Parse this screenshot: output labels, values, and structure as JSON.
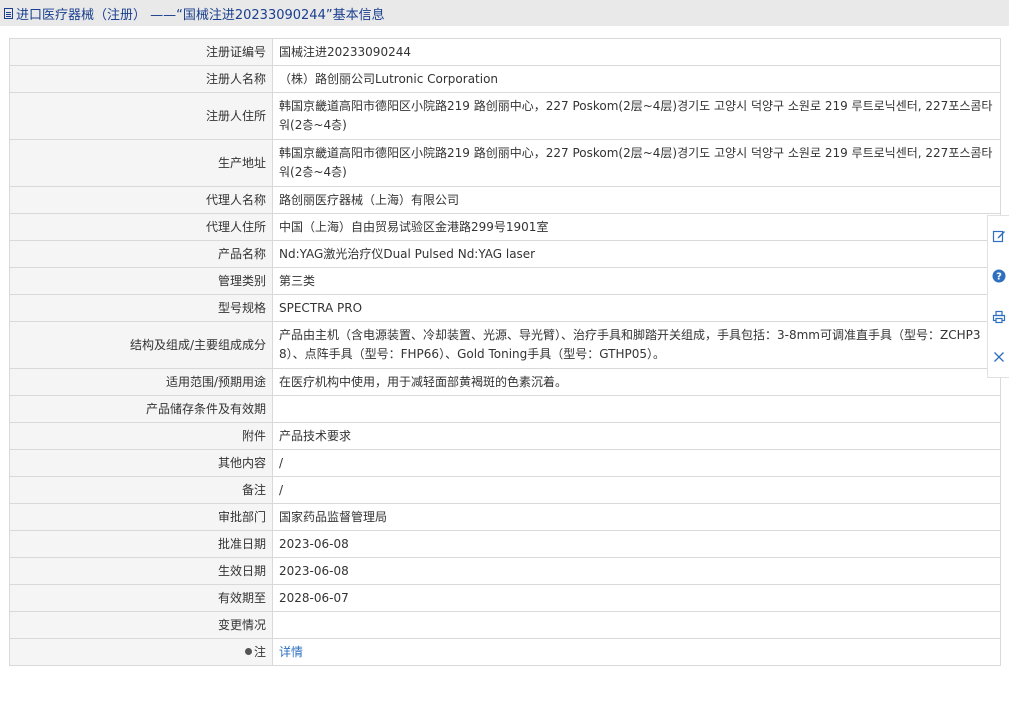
{
  "header": {
    "title": "进口医疗器械（注册） ——“国械注进20233090244”基本信息",
    "icon": "document-icon"
  },
  "rows": [
    {
      "label": "注册证编号",
      "value": "国械注进20233090244"
    },
    {
      "label": "注册人名称",
      "value": "（株）路创丽公司Lutronic Corporation"
    },
    {
      "label": "注册人住所",
      "value": "韩国京畿道高阳市德阳区小院路219 路创丽中心，227 Poskom(2层~4层)경기도 고양시 덕양구 소원로 219 루트로닉센터, 227포스콤타워(2층~4층)"
    },
    {
      "label": "生产地址",
      "value": "韩国京畿道高阳市德阳区小院路219 路创丽中心，227 Poskom(2层~4层)경기도 고양시 덕양구 소원로 219 루트로닉센터, 227포스콤타워(2층~4층)"
    },
    {
      "label": "代理人名称",
      "value": "路创丽医疗器械（上海）有限公司"
    },
    {
      "label": "代理人住所",
      "value": "中国（上海）自由贸易试验区金港路299号1901室"
    },
    {
      "label": "产品名称",
      "value": "Nd:YAG激光治疗仪Dual Pulsed Nd:YAG laser"
    },
    {
      "label": "管理类别",
      "value": "第三类"
    },
    {
      "label": "型号规格",
      "value": "SPECTRA PRO"
    },
    {
      "label": "结构及组成/主要组成成分",
      "value": "产品由主机（含电源装置、冷却装置、光源、导光臂）、治疗手具和脚踏开关组成，手具包括：3-8mm可调准直手具（型号：ZCHP38）、点阵手具（型号：FHP66）、Gold Toning手具（型号：GTHP05）。"
    },
    {
      "label": "适用范围/预期用途",
      "value": "在医疗机构中使用，用于减轻面部黄褐斑的色素沉着。"
    },
    {
      "label": "产品储存条件及有效期",
      "value": ""
    },
    {
      "label": "附件",
      "value": "产品技术要求"
    },
    {
      "label": "其他内容",
      "value": "/"
    },
    {
      "label": "备注",
      "value": "/"
    },
    {
      "label": "审批部门",
      "value": "国家药品监督管理局"
    },
    {
      "label": "批准日期",
      "value": "2023-06-08"
    },
    {
      "label": "生效日期",
      "value": "2023-06-08"
    },
    {
      "label": "有效期至",
      "value": "2028-06-07"
    },
    {
      "label": "变更情况",
      "value": ""
    },
    {
      "label": "注",
      "value": "详情"
    }
  ],
  "side_tools": [
    "edit-icon",
    "help-icon",
    "print-icon",
    "close-icon"
  ],
  "colors": {
    "header_text": "#1a3f8f",
    "link": "#2f6fbf",
    "label_bg": "#f5f5f5",
    "header_bg": "#e9e9e9",
    "tool_blue": "#2f6fbf"
  }
}
